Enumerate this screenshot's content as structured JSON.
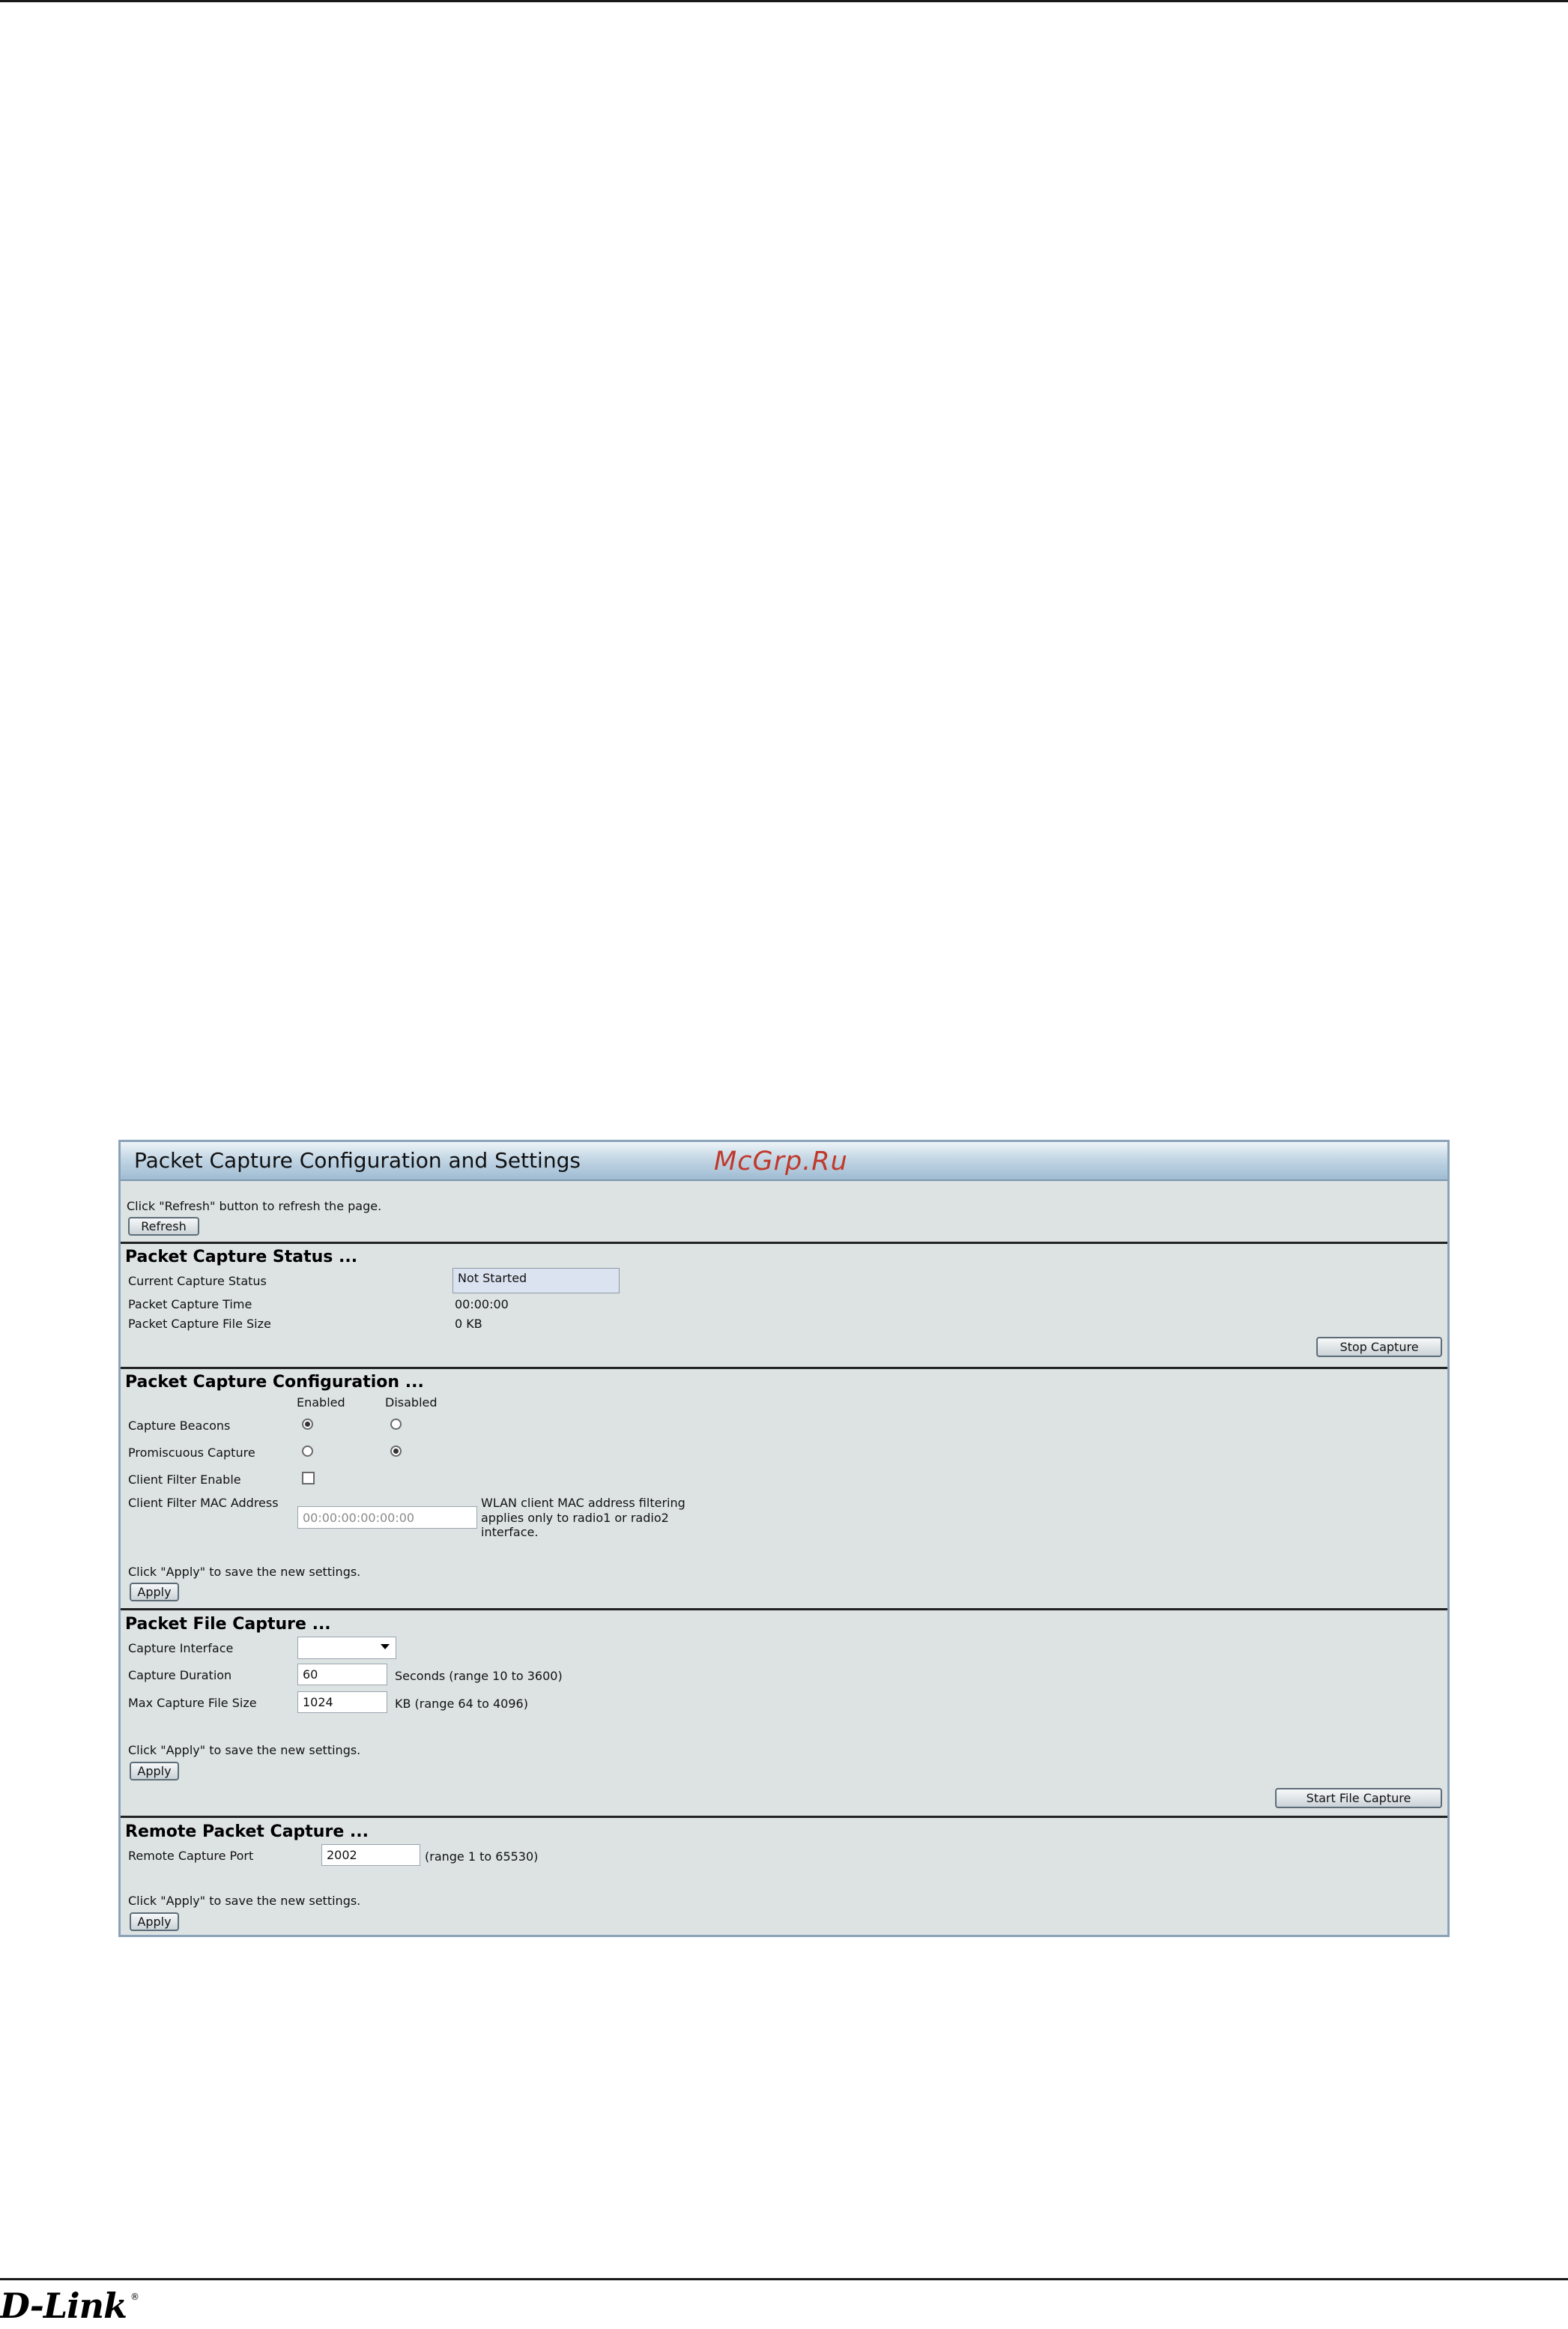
{
  "watermark": "McGrp.Ru",
  "panel": {
    "title": "Packet Capture Configuration and Settings"
  },
  "refresh": {
    "hint": "Click \"Refresh\" button to refresh the page.",
    "button": "Refresh"
  },
  "status": {
    "title": "Packet Capture Status ...",
    "rows": [
      {
        "label": "Current Capture Status",
        "value": "Not Started"
      },
      {
        "label": "Packet Capture Time",
        "value": "00:00:00"
      },
      {
        "label": "Packet Capture File Size",
        "value": "0 KB"
      }
    ],
    "stop_button": "Stop Capture"
  },
  "config": {
    "title": "Packet Capture Configuration ...",
    "col_enabled": "Enabled",
    "col_disabled": "Disabled",
    "capture_beacons": {
      "label": "Capture Beacons",
      "selected": "Enabled"
    },
    "promiscuous": {
      "label": "Promiscuous Capture",
      "selected": "Disabled"
    },
    "client_filter": {
      "label": "Client Filter Enable",
      "checked": false
    },
    "mac": {
      "label": "Client Filter MAC Address",
      "value": "00:00:00:00:00:00",
      "note_line1": "WLAN client MAC address filtering",
      "note_line2": "applies only to radio1 or radio2",
      "note_line3": "interface."
    },
    "apply_hint": "Click \"Apply\" to save the new settings.",
    "apply_button": "Apply"
  },
  "file_capture": {
    "title": "Packet File Capture ...",
    "interface_label": "Capture Interface",
    "interface_value": "",
    "duration_label": "Capture Duration",
    "duration_value": "60",
    "duration_note": "Seconds (range 10 to 3600)",
    "max_size_label": "Max Capture File Size",
    "max_size_value": "1024",
    "max_size_note": "KB (range 64 to 4096)",
    "apply_hint": "Click \"Apply\" to save the new settings.",
    "apply_button": "Apply",
    "start_button": "Start File Capture"
  },
  "remote": {
    "title": "Remote Packet Capture ...",
    "port_label": "Remote Capture Port",
    "port_value": "2002",
    "port_note": "(range 1 to 65530)",
    "apply_hint": "Click \"Apply\" to save the new settings.",
    "apply_button": "Apply"
  },
  "footer": {
    "logo": "D-Link",
    "logo_mark": "®"
  }
}
